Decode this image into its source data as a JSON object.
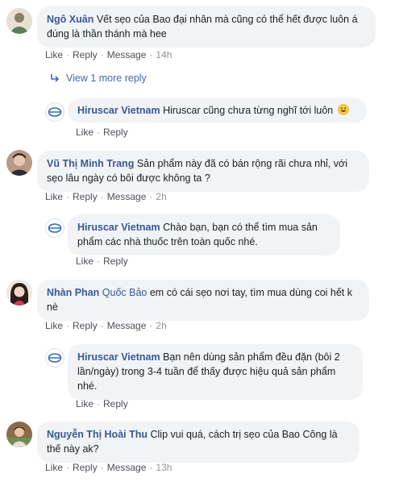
{
  "comments": [
    {
      "name_bold": "Ngô Xuân",
      "name_light": "",
      "text": "Vết sẹo của Bao đại nhân mà cũng có thể hết được luôn á đúng là thần thánh mà hee",
      "like": "Like",
      "reply": "Reply",
      "message": "Message",
      "time": "14h"
    },
    {
      "name_bold": "Vũ Thị Minh Trang",
      "name_light": "",
      "text": "Sản phẩm này đã có bán rộng rãi chưa nhỉ, với sẹo lâu ngày có bôi được không ta ?",
      "like": "Like",
      "reply": "Reply",
      "message": "Message",
      "time": "2h"
    },
    {
      "name_bold": "Nhàn Phan",
      "name_light": "Quốc Bảo",
      "text": "em có cái sẹo nơi tay, tìm mua dùng coi hết k nè",
      "like": "Like",
      "reply": "Reply",
      "message": "Message",
      "time": "2h"
    },
    {
      "name_bold": "Nguyễn Thị Hoài Thu",
      "name_light": "",
      "text": "Clip vui quá, cách trị sẹo của Bao Công là thế này ak?",
      "like": "Like",
      "reply": "Reply",
      "message": "Message",
      "time": "13h"
    }
  ],
  "view_more": "View 1 more reply",
  "replies": [
    {
      "name": "Hiruscar Vietnam",
      "text": "Hiruscar cũng chưa từng nghĩ tới luôn",
      "emoji": "grinning-face",
      "like": "Like",
      "reply": "Reply"
    },
    {
      "name": "Hiruscar Vietnam",
      "text": "Chào bạn, bạn có thể tìm mua sản phẩm các nhà thuốc trên toàn quốc nhé.",
      "like": "Like",
      "reply": "Reply"
    },
    {
      "name": "Hiruscar Vietnam",
      "text": "Bạn nên dùng sản phẩm đều đặn (bôi 2 lần/ngày) trong 3-4 tuần để thấy được hiệu quả sản phẩm nhé.",
      "like": "Like",
      "reply": "Reply"
    }
  ],
  "colors": {
    "link": "#385898",
    "bubble": "#f2f3f5",
    "meta": "#90949c",
    "action": "#4b4f56",
    "view_more": "#4267b2"
  }
}
